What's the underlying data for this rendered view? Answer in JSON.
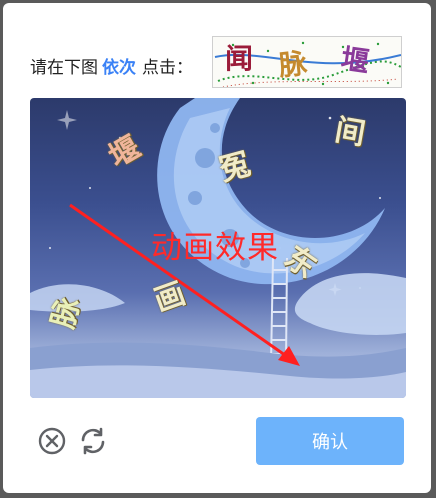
{
  "prompt": {
    "prefix": "请在下图",
    "highlight": "依次",
    "suffix": "点击："
  },
  "target_chars": [
    "闻",
    "脉",
    "堰"
  ],
  "captcha_chars": [
    "堰",
    "冤",
    "间",
    "东",
    "画",
    "脉"
  ],
  "annotation_label": "动画效果",
  "buttons": {
    "close_icon": "close-circle-icon",
    "refresh_icon": "refresh-icon",
    "confirm_label": "确认"
  },
  "colors": {
    "highlight": "#3b82f6",
    "confirm_bg": "#6db3fb",
    "annotation": "#ff2a2a"
  }
}
